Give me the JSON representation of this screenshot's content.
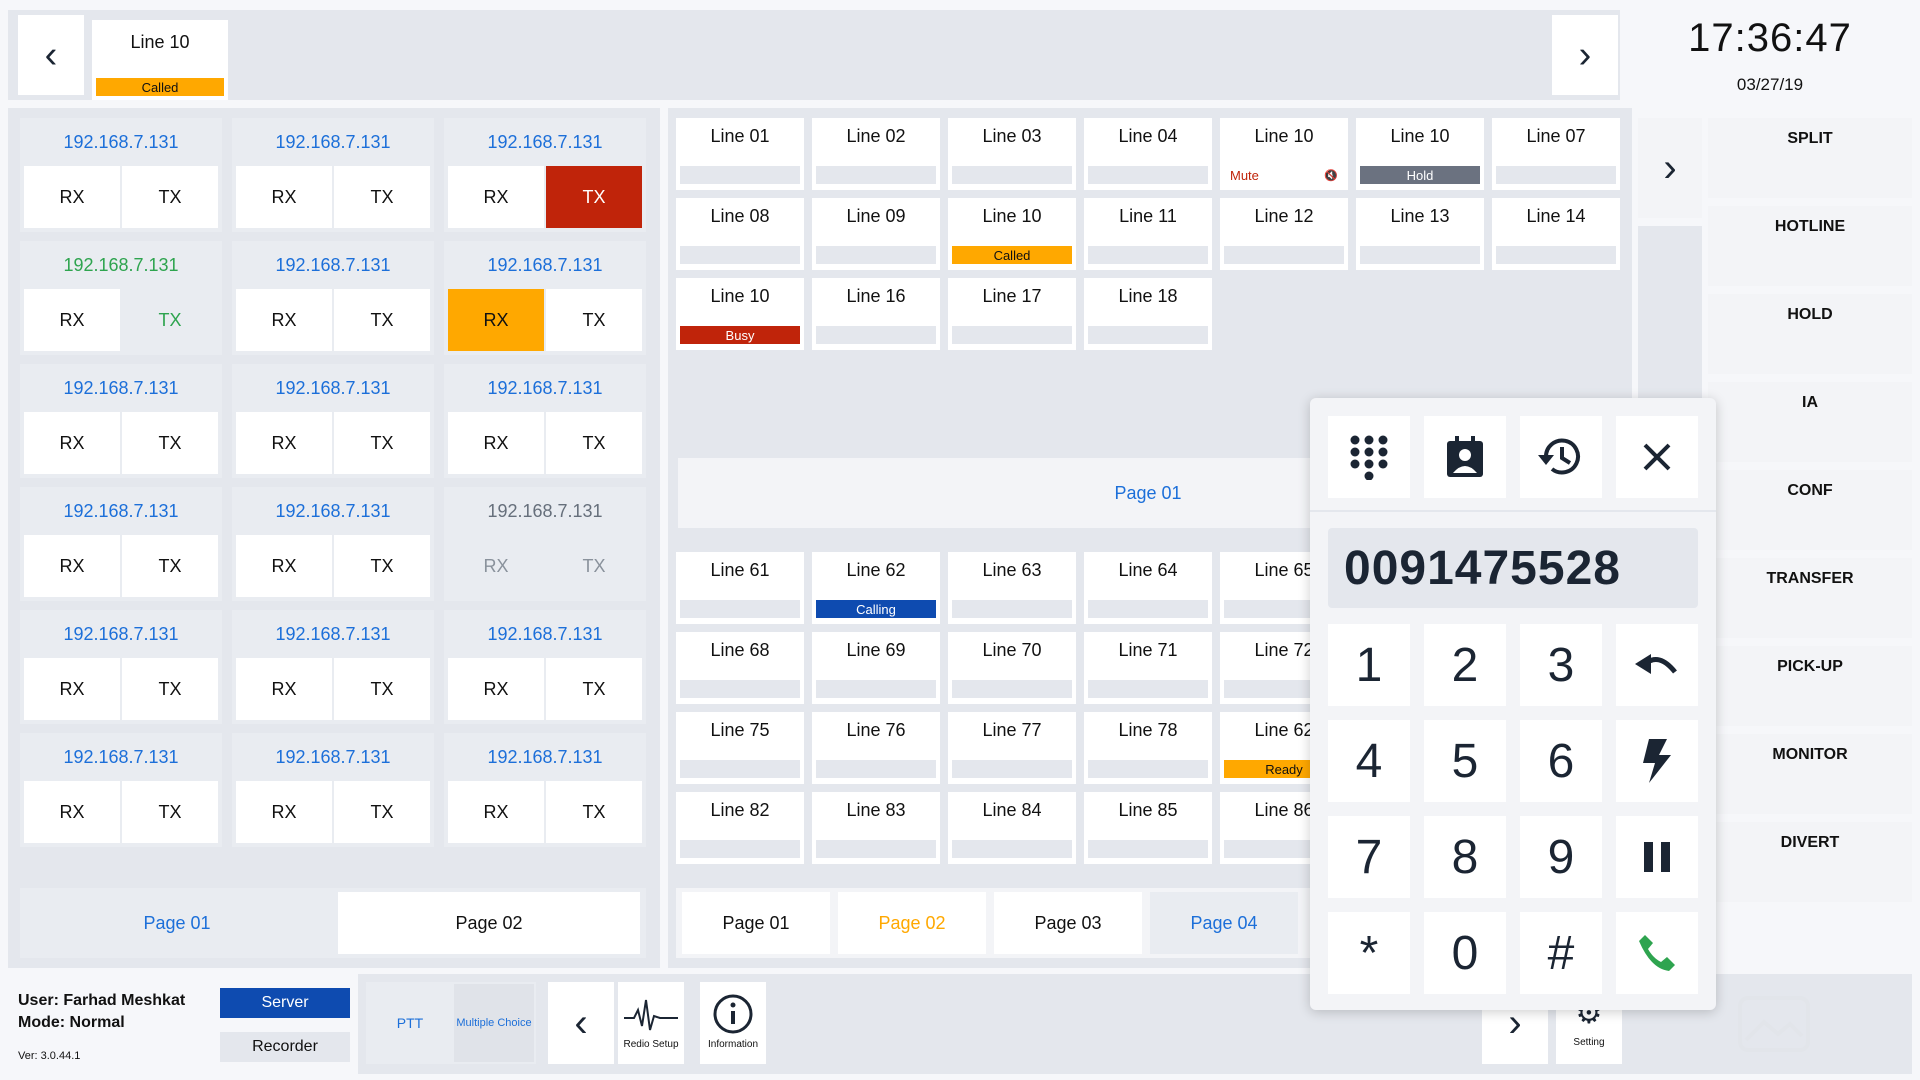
{
  "topbar": {
    "line": "Line 10",
    "status": "Called",
    "time": "17:36:47",
    "date": "03/27/19"
  },
  "radios": [
    {
      "ip": "192.168.7.131",
      "rx": "RX",
      "tx": "TX",
      "state": "normal"
    },
    {
      "ip": "192.168.7.131",
      "rx": "RX",
      "tx": "TX",
      "state": "normal"
    },
    {
      "ip": "192.168.7.131",
      "rx": "RX",
      "tx": "TX",
      "state": "tx-red"
    },
    {
      "ip": "192.168.7.131",
      "rx": "RX",
      "tx": "TX",
      "state": "green"
    },
    {
      "ip": "192.168.7.131",
      "rx": "RX",
      "tx": "TX",
      "state": "normal"
    },
    {
      "ip": "192.168.7.131",
      "rx": "RX",
      "tx": "TX",
      "state": "rx-amber"
    },
    {
      "ip": "192.168.7.131",
      "rx": "RX",
      "tx": "TX",
      "state": "normal"
    },
    {
      "ip": "192.168.7.131",
      "rx": "RX",
      "tx": "TX",
      "state": "normal"
    },
    {
      "ip": "192.168.7.131",
      "rx": "RX",
      "tx": "TX",
      "state": "normal"
    },
    {
      "ip": "192.168.7.131",
      "rx": "RX",
      "tx": "TX",
      "state": "normal"
    },
    {
      "ip": "192.168.7.131",
      "rx": "RX",
      "tx": "TX",
      "state": "normal"
    },
    {
      "ip": "192.168.7.131",
      "rx": "RX",
      "tx": "TX",
      "state": "disabled"
    },
    {
      "ip": "192.168.7.131",
      "rx": "RX",
      "tx": "TX",
      "state": "normal"
    },
    {
      "ip": "192.168.7.131",
      "rx": "RX",
      "tx": "TX",
      "state": "normal"
    },
    {
      "ip": "192.168.7.131",
      "rx": "RX",
      "tx": "TX",
      "state": "normal"
    },
    {
      "ip": "192.168.7.131",
      "rx": "RX",
      "tx": "TX",
      "state": "normal"
    },
    {
      "ip": "192.168.7.131",
      "rx": "RX",
      "tx": "TX",
      "state": "normal"
    },
    {
      "ip": "192.168.7.131",
      "rx": "RX",
      "tx": "TX",
      "state": "normal"
    }
  ],
  "radio_pages": [
    "Page 01",
    "Page 02"
  ],
  "lines_top": [
    {
      "name": "Line 01",
      "status": ""
    },
    {
      "name": "Line 02",
      "status": ""
    },
    {
      "name": "Line 03",
      "status": ""
    },
    {
      "name": "Line 04",
      "status": ""
    },
    {
      "name": "Line 10",
      "status": "Mute",
      "kind": "mute"
    },
    {
      "name": "Line 10",
      "status": "Hold",
      "kind": "hold"
    },
    {
      "name": "Line 07",
      "status": ""
    },
    {
      "name": "Line 08",
      "status": ""
    },
    {
      "name": "Line 09",
      "status": ""
    },
    {
      "name": "Line 10",
      "status": "Called",
      "kind": "called"
    },
    {
      "name": "Line 11",
      "status": ""
    },
    {
      "name": "Line 12",
      "status": ""
    },
    {
      "name": "Line 13",
      "status": ""
    },
    {
      "name": "Line 14",
      "status": ""
    },
    {
      "name": "Line 10",
      "status": "Busy",
      "kind": "busy"
    },
    {
      "name": "Line 16",
      "status": ""
    },
    {
      "name": "Line 17",
      "status": ""
    },
    {
      "name": "Line 18",
      "status": ""
    }
  ],
  "page_label": "Page 01",
  "lines_bottom": [
    {
      "name": "Line 61",
      "status": ""
    },
    {
      "name": "Line 62",
      "status": "Calling",
      "kind": "calling"
    },
    {
      "name": "Line 63",
      "status": ""
    },
    {
      "name": "Line 64",
      "status": ""
    },
    {
      "name": "Line 65",
      "status": ""
    },
    {
      "name": "Line 68",
      "status": ""
    },
    {
      "name": "Line 69",
      "status": ""
    },
    {
      "name": "Line 70",
      "status": ""
    },
    {
      "name": "Line 71",
      "status": ""
    },
    {
      "name": "Line 72",
      "status": ""
    },
    {
      "name": "Line 75",
      "status": ""
    },
    {
      "name": "Line 76",
      "status": ""
    },
    {
      "name": "Line 77",
      "status": ""
    },
    {
      "name": "Line 78",
      "status": ""
    },
    {
      "name": "Line 62",
      "status": "Ready",
      "kind": "called"
    },
    {
      "name": "Line 82",
      "status": ""
    },
    {
      "name": "Line 83",
      "status": ""
    },
    {
      "name": "Line 84",
      "status": ""
    },
    {
      "name": "Line 85",
      "status": ""
    },
    {
      "name": "Line 86",
      "status": ""
    }
  ],
  "line_pages": [
    "Page 01",
    "Page 02",
    "Page 03",
    "Page 04"
  ],
  "functions": [
    "SPLIT",
    "HOTLINE",
    "HOLD",
    "IA",
    "CONF",
    "TRANSFER",
    "PICK-UP",
    "MONITOR",
    "DIVERT"
  ],
  "user": {
    "name": "User: Farhad Meshkat",
    "mode": "Mode: Normal",
    "version": "Ver: 3.0.44.1"
  },
  "buttons": {
    "server": "Server",
    "recorder": "Recorder",
    "ptt": "PTT",
    "multiple": "Multiple Choice",
    "radio_setup": "Redio Setup",
    "information": "Information",
    "setting": "Setting"
  },
  "dialer": {
    "number": "0091475528",
    "keys": [
      "1",
      "2",
      "3",
      "4",
      "5",
      "6",
      "7",
      "8",
      "9",
      "*",
      "0",
      "#"
    ]
  },
  "colors": {
    "blue": "#1c6fd9",
    "green": "#2ea44f",
    "amber": "#ffa800",
    "red": "#c0240a",
    "navy": "#0e4bb0",
    "grey": "#666f7b"
  }
}
